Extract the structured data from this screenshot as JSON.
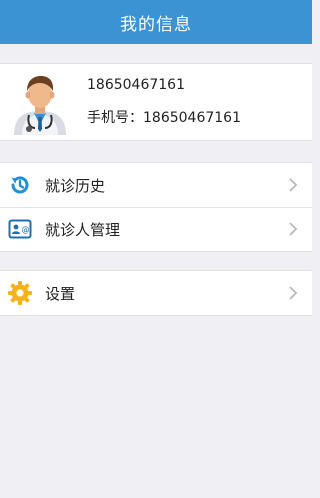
{
  "nav": {
    "title": "我的信息"
  },
  "profile": {
    "name": "18650467161",
    "phone_label": "手机号：18650467161",
    "avatar_icon": "doctor-avatar-icon"
  },
  "menu": {
    "history": {
      "label": "就诊历史",
      "icon": "history-icon"
    },
    "patients": {
      "label": "就诊人管理",
      "icon": "contact-card-icon"
    },
    "settings": {
      "label": "设置",
      "icon": "gear-icon"
    }
  },
  "colors": {
    "header": "#3b93d3",
    "background": "#efeff4",
    "accent_blue": "#1f8fd6",
    "gear": "#f5b21a"
  }
}
